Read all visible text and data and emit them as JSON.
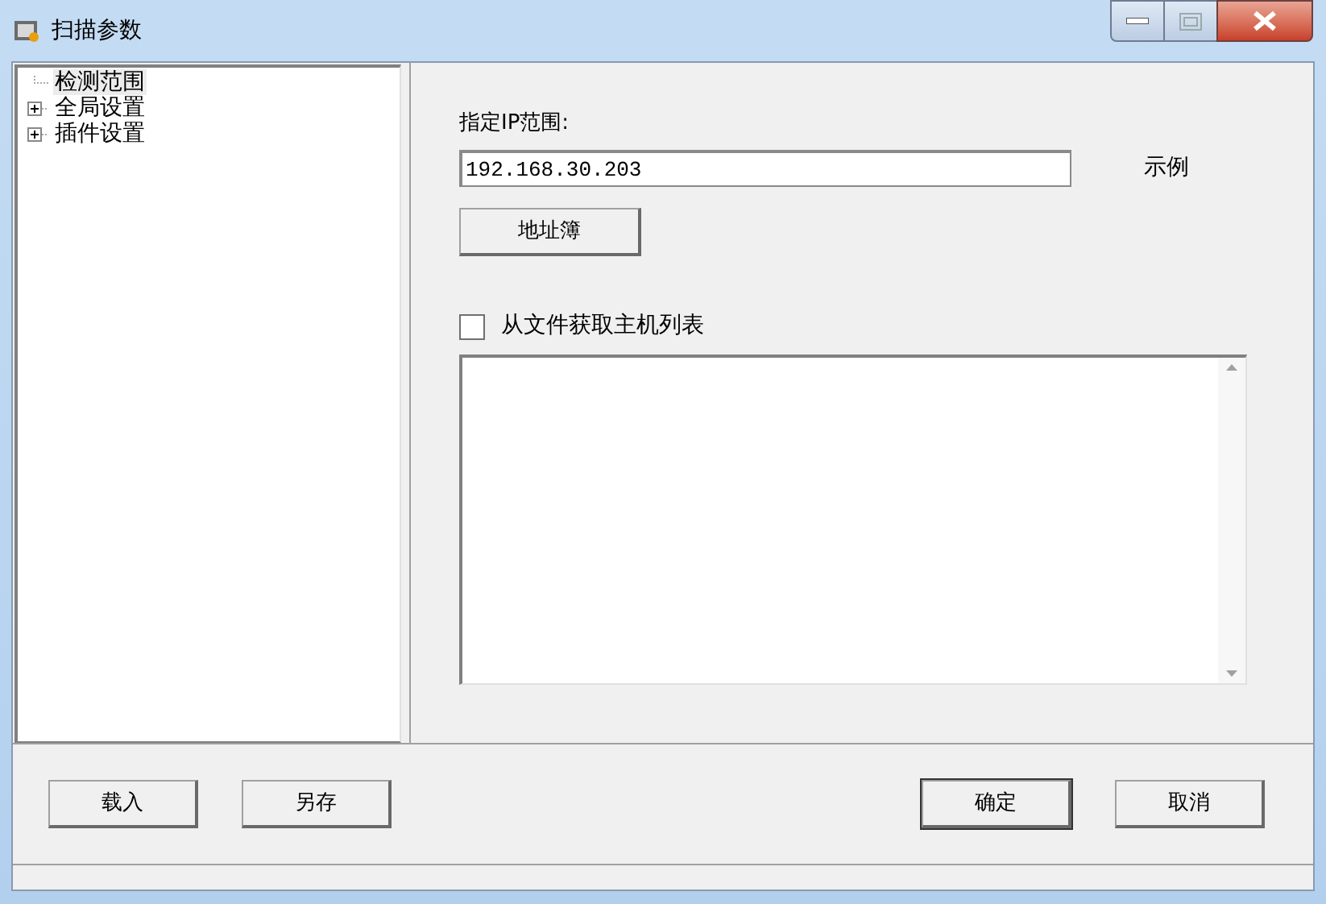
{
  "window": {
    "title": "扫描参数"
  },
  "tree": [
    {
      "label": "检测范围",
      "selected": true
    },
    {
      "label": "全局设置",
      "selected": false,
      "expanded": false,
      "has_children": true
    },
    {
      "label": "插件设置",
      "selected": false,
      "expanded": false,
      "has_children": true
    }
  ],
  "ip_range": {
    "label": "指定IP范围:",
    "value": "192.168.30.203",
    "example": "示例"
  },
  "address_book_button": "地址簿",
  "file_hosts": {
    "label": "从文件获取主机列表",
    "checked": false
  },
  "buttons_left": [
    "载入",
    "另存"
  ],
  "buttons_right": [
    "确定",
    "取消"
  ]
}
